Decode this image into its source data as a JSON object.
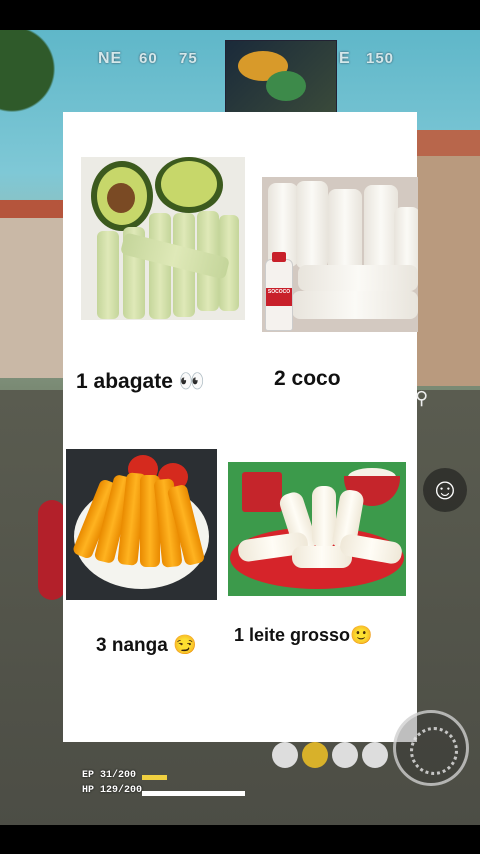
{
  "hud": {
    "compass": [
      "NE",
      "60",
      "75",
      "E",
      "150"
    ],
    "ep_text": "EP 31/200",
    "hp_text": "HP 129/200",
    "ep_ratio": 0.155,
    "hp_ratio": 0.645,
    "smiley_glyph": "☺",
    "pin_glyph": "⚲"
  },
  "items": [
    {
      "label": "1 abagate",
      "emoji": "👀"
    },
    {
      "label": "2 coco",
      "emoji": ""
    },
    {
      "label": "3 nanga",
      "emoji": "😏"
    },
    {
      "label": "1 leite grosso",
      "emoji": "🙂"
    }
  ],
  "coco_bottle_text": "SOCOCO",
  "colors": {
    "card_bg": "#ffffff",
    "ep_bar": "#f0d040",
    "hp_bar": "#ffffff",
    "hp_bar_low": "#7fd0e0"
  }
}
